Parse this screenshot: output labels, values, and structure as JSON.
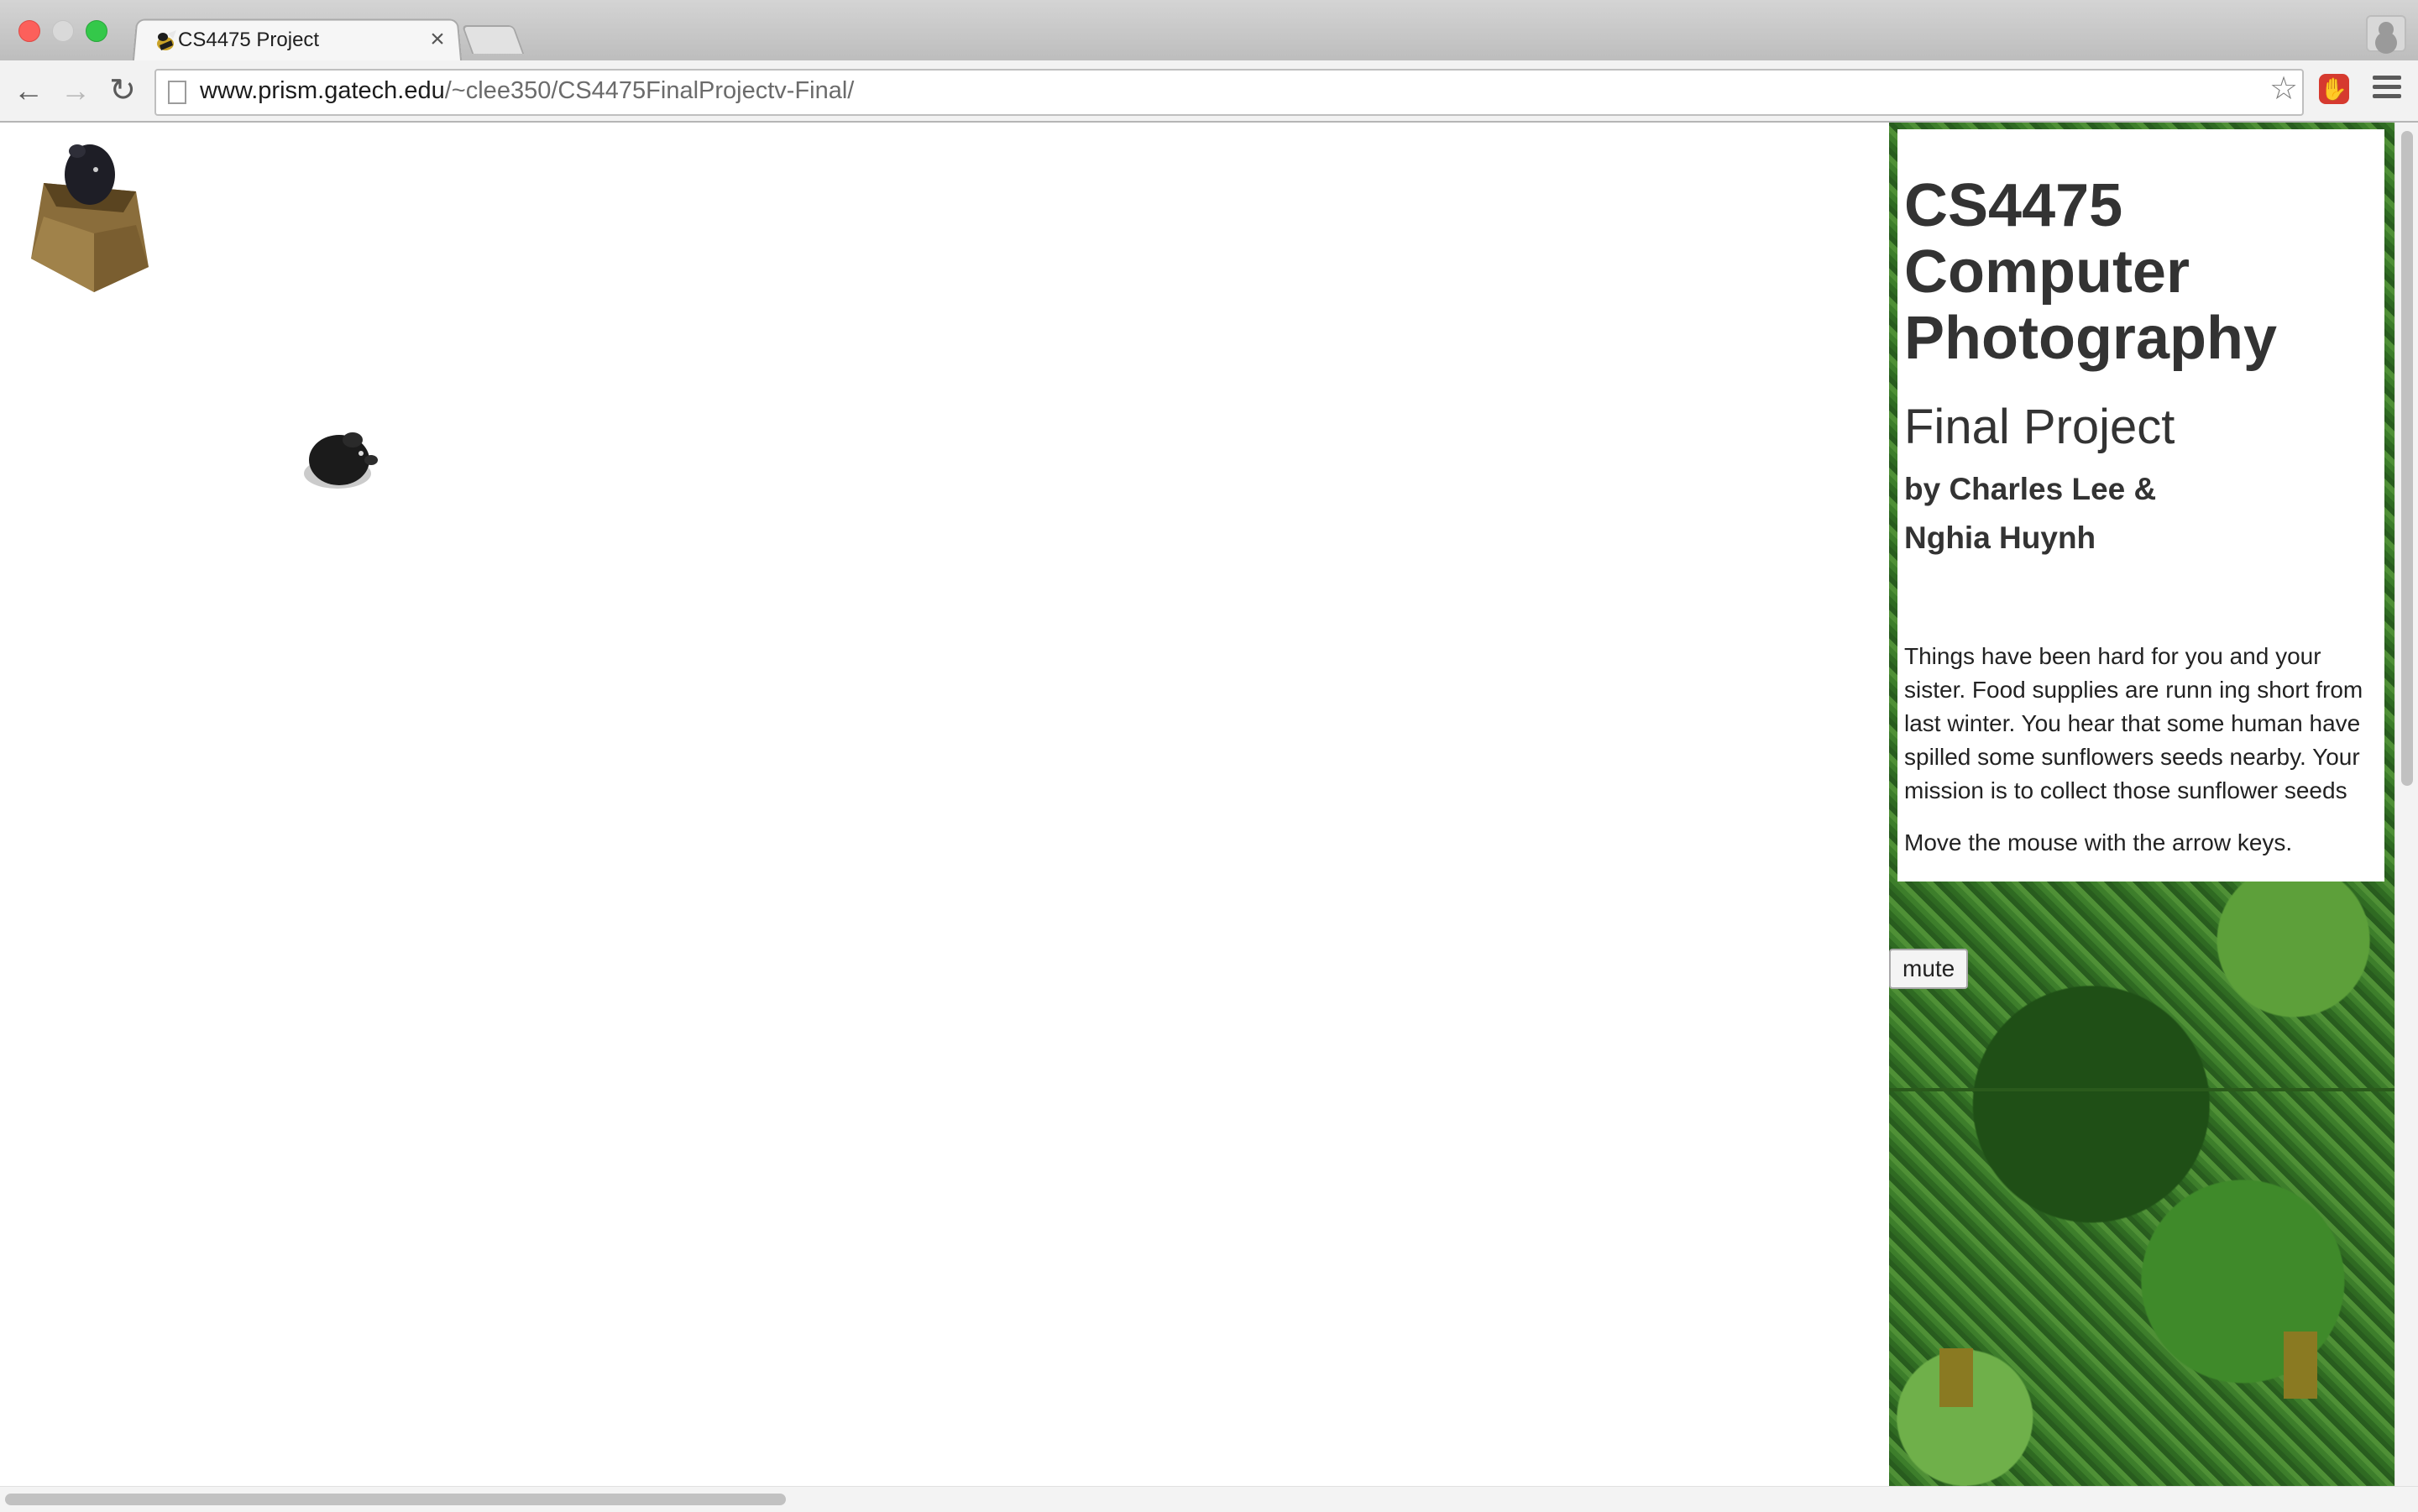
{
  "browser": {
    "tab": {
      "title": "CS4475 Project",
      "close_glyph": "×",
      "favicon": "gatech-buzz-icon"
    },
    "nav": {
      "back_glyph": "←",
      "forward_glyph": "→",
      "reload_glyph": "↻"
    },
    "address": {
      "host": "www.prism.gatech.edu",
      "path": "/~clee350/CS4475FinalProjectv-Final/"
    },
    "star_glyph": "☆",
    "extension_glyph": "✋"
  },
  "game": {
    "box_sprite": "hamster-in-wooden-box",
    "player_sprite": "black-mouse"
  },
  "info": {
    "title": "CS4475 Computer Photography",
    "subtitle": "Final Project",
    "authors_line1": "by Charles Lee &",
    "authors_line2": "Nghia Huynh",
    "story": "Things have been hard for you and your sister. Food supplies are runn ing short from last winter. You hear that some human have spilled some sunflowers seeds nearby. Your mission is to collect those sunflower seeds",
    "instructions": "Move the mouse with the arrow keys."
  },
  "controls": {
    "mute_label": "mute"
  },
  "colors": {
    "forest_dark": "#1f4f16",
    "forest_mid": "#3d7e2b",
    "forest_light": "#6fb04a",
    "text": "#333333"
  }
}
